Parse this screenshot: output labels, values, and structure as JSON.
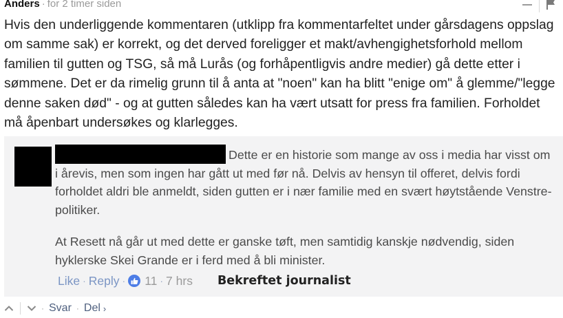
{
  "comment": {
    "author": "Anders",
    "separator": "·",
    "time": "for 2 timer siden",
    "text": "Hvis den underliggende kommentaren (utklipp fra kommentarfeltet under gårsdagens oppslag om samme sak) er korrekt, og det derved foreligger et makt/avhengighetsforhold mellom familien til gutten og TSG, så må Lurås (og forhåpentligvis andre medier) gå dette etter i sømmene. Det er da rimelig grunn til å anta at \"noen\" kan ha blitt \"enige om\" å glemme/\"legge denne saken død\" - og at gutten således kan ha vært utsatt for press fra familien. Forholdet må åpenbart undersøkes og klarlegges."
  },
  "quoted": {
    "paragraph1": "Dette er en historie som mange av oss i media har visst om i årevis, men som ingen har gått ut med før nå. Delvis av hensyn til offeret, delvis fordi forholdet aldri ble anmeldt, siden gutten er i nær familie med en svært høytstående Venstre-politiker.",
    "paragraph2": "At Resett nå går ut med dette er ganske tøft, men samtidig kanskje nødvendig, siden hyklerske Skei Grande er i ferd med å bli minister.",
    "like_label": "Like",
    "reply_label": "Reply",
    "dot": "·",
    "like_count": "11",
    "time": "7 hrs",
    "badge_text": "Bekreftet journalist"
  },
  "bottom_actions": {
    "reply_label": "Svar",
    "share_label": "Del",
    "share_chevron": "›",
    "dot": "·"
  },
  "colors": {
    "link_blue": "#7b95c4",
    "like_badge": "#4d7de6",
    "quote_bg": "#f3f3f4"
  }
}
